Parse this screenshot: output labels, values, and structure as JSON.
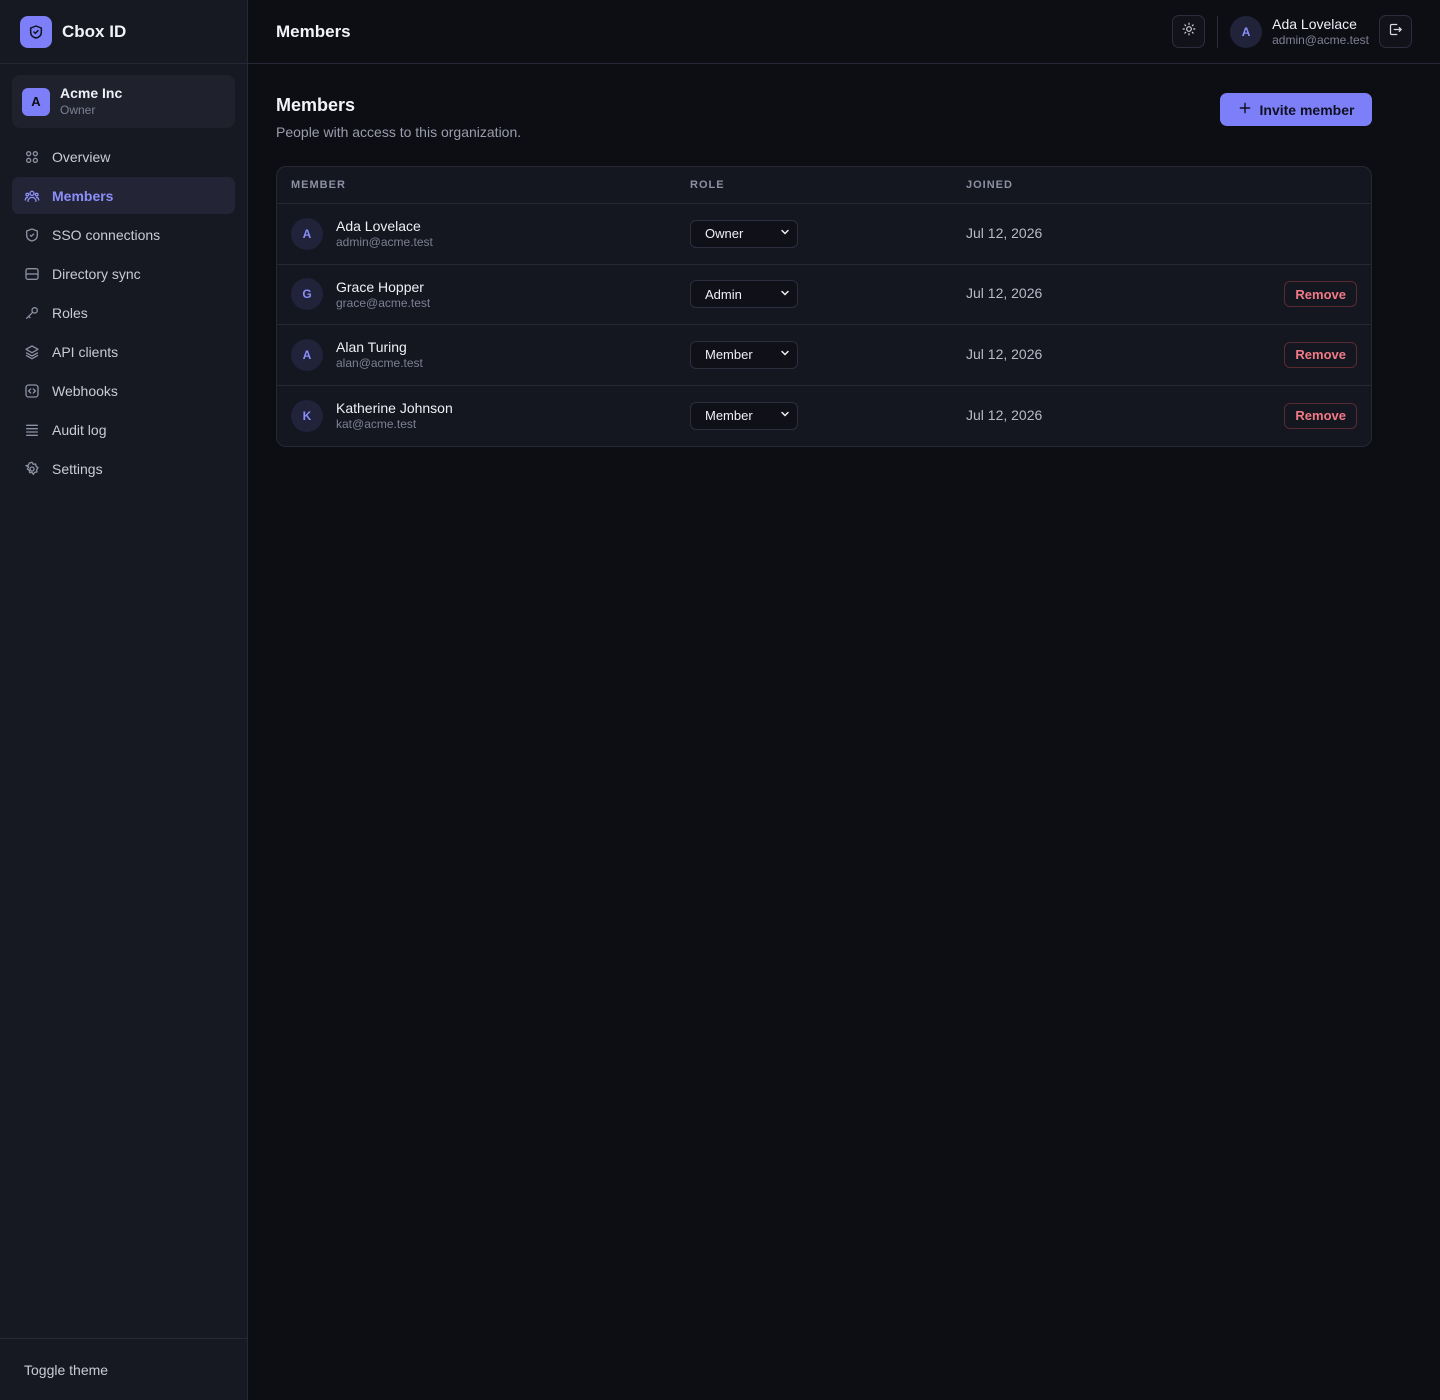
{
  "app": {
    "name": "Cbox ID"
  },
  "org": {
    "initial": "A",
    "name": "Acme Inc",
    "role": "Owner"
  },
  "nav": [
    {
      "label": "Overview",
      "icon": "grid-icon",
      "active": false
    },
    {
      "label": "Members",
      "icon": "users-icon",
      "active": true
    },
    {
      "label": "SSO connections",
      "icon": "shield-icon",
      "active": false
    },
    {
      "label": "Directory sync",
      "icon": "database-icon",
      "active": false
    },
    {
      "label": "Roles",
      "icon": "key-icon",
      "active": false
    },
    {
      "label": "API clients",
      "icon": "layers-icon",
      "active": false
    },
    {
      "label": "Webhooks",
      "icon": "code-icon",
      "active": false
    },
    {
      "label": "Audit log",
      "icon": "list-icon",
      "active": false
    },
    {
      "label": "Settings",
      "icon": "gear-icon",
      "active": false
    }
  ],
  "footer": {
    "toggle_label": "Toggle theme"
  },
  "topbar": {
    "title": "Members",
    "user": {
      "initial": "A",
      "name": "Ada Lovelace",
      "email": "admin@acme.test"
    }
  },
  "page": {
    "title": "Members",
    "subtitle": "People with access to this organization.",
    "invite_label": "Invite member"
  },
  "table": {
    "headers": {
      "member": "MEMBER",
      "role": "ROLE",
      "joined": "JOINED"
    },
    "rows": [
      {
        "initial": "A",
        "name": "Ada Lovelace",
        "email": "admin@acme.test",
        "role": "Owner",
        "joined": "Jul 12, 2026",
        "remove": ""
      },
      {
        "initial": "G",
        "name": "Grace Hopper",
        "email": "grace@acme.test",
        "role": "Admin",
        "joined": "Jul 12, 2026",
        "remove": "Remove"
      },
      {
        "initial": "A",
        "name": "Alan Turing",
        "email": "alan@acme.test",
        "role": "Member",
        "joined": "Jul 12, 2026",
        "remove": "Remove"
      },
      {
        "initial": "K",
        "name": "Katherine Johnson",
        "email": "kat@acme.test",
        "role": "Member",
        "joined": "Jul 12, 2026",
        "remove": "Remove"
      }
    ]
  },
  "colors": {
    "accent": "#7c7ff7",
    "danger": "#f07a86",
    "background": "#0d0e14",
    "sidebar": "#161822"
  }
}
